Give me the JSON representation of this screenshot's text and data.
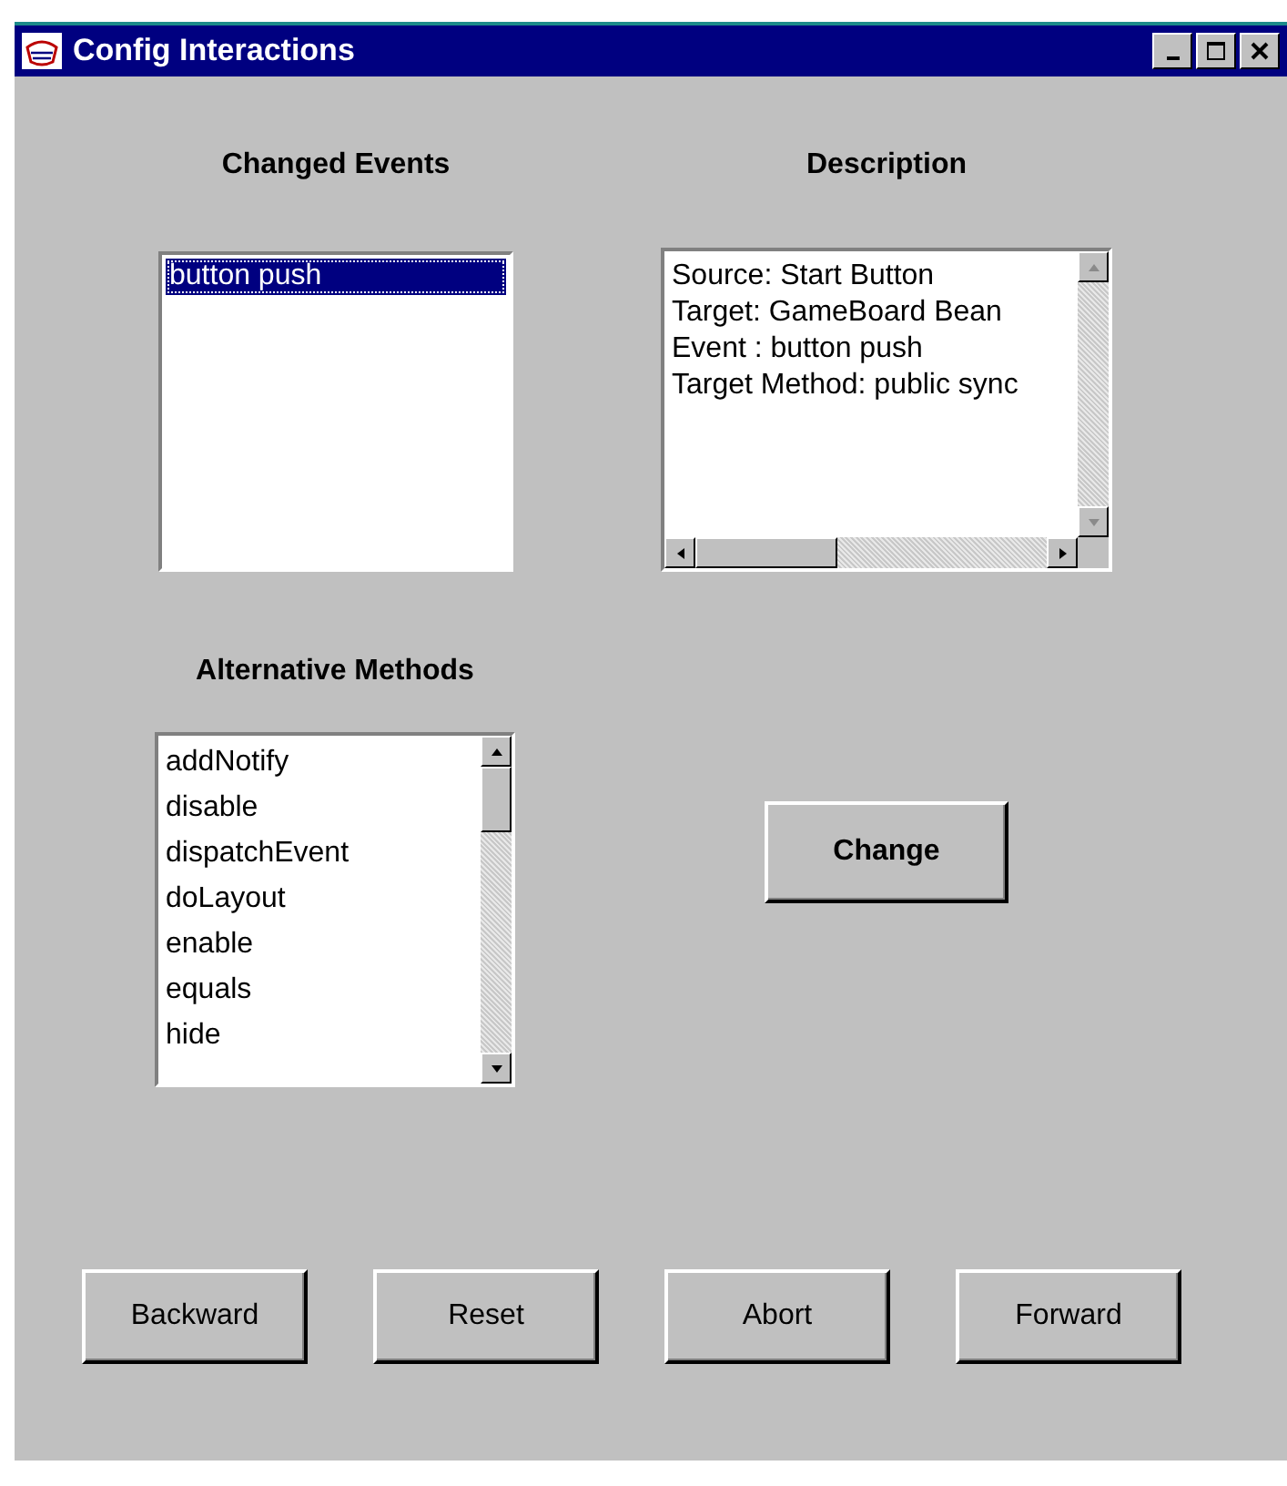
{
  "window": {
    "title": "Config Interactions"
  },
  "changed_events": {
    "label": "Changed Events",
    "items": [
      {
        "text": "button push",
        "selected": true
      }
    ]
  },
  "description": {
    "label": "Description",
    "lines": [
      "Source: Start Button",
      "Target: GameBoard Bean",
      "Event : button push",
      "Target Method: public sync"
    ]
  },
  "alternative_methods": {
    "label": "Alternative Methods",
    "items": [
      {
        "text": "addNotify",
        "selected": false
      },
      {
        "text": "disable",
        "selected": false
      },
      {
        "text": "dispatchEvent",
        "selected": false
      },
      {
        "text": "doLayout",
        "selected": false
      },
      {
        "text": "enable",
        "selected": false
      },
      {
        "text": "equals",
        "selected": false
      },
      {
        "text": "hide",
        "selected": false
      }
    ]
  },
  "change_button": "Change",
  "buttons": [
    "Backward",
    "Reset",
    "Abort",
    "Forward"
  ]
}
